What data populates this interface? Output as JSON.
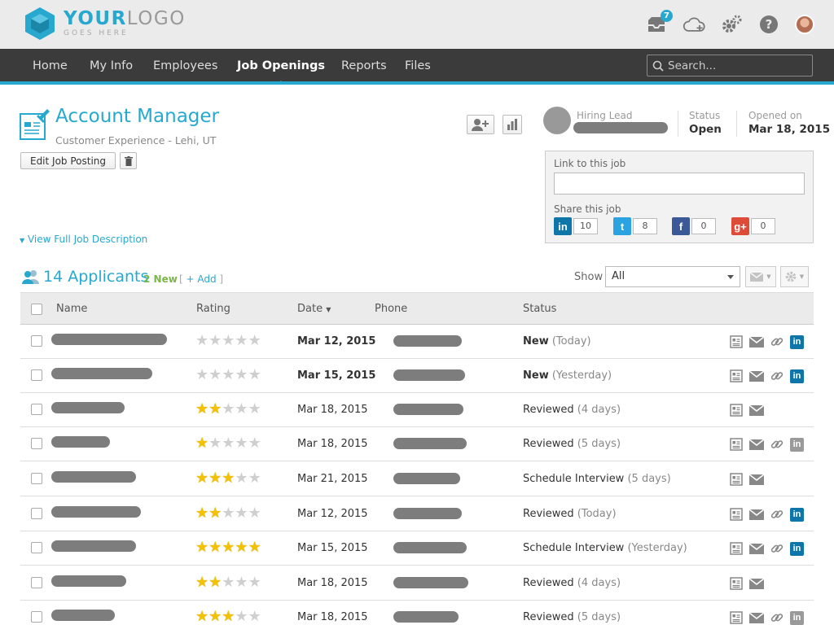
{
  "header": {
    "logo_main_a": "YOUR",
    "logo_main_b": "LOGO",
    "logo_sub": "GOES HERE",
    "inbox_count": "7",
    "icons": [
      "inbox-icon",
      "cloud-upload-icon",
      "gear-icon",
      "help-icon",
      "avatar"
    ]
  },
  "nav": {
    "items": [
      "Home",
      "My Info",
      "Employees",
      "Job Openings",
      "Reports",
      "Files"
    ],
    "active": "Job Openings",
    "search_placeholder": "Search..."
  },
  "job": {
    "title": "Account Manager",
    "subtitle": "Customer Experience - Lehi, UT",
    "edit_label": "Edit Job Posting",
    "view_desc": "View Full Job Description",
    "hiring_lead_label": "Hiring Lead",
    "status_label": "Status",
    "status_value": "Open",
    "opened_label": "Opened on",
    "opened_value": "Mar 18, 2015"
  },
  "share": {
    "link_label": "Link to this job",
    "share_label": "Share this job",
    "networks": [
      {
        "name": "linkedin",
        "glyph": "in",
        "count": "10",
        "color": "#0e76a8"
      },
      {
        "name": "twitter",
        "glyph": "t",
        "count": "8",
        "color": "#2aa3e0"
      },
      {
        "name": "facebook",
        "glyph": "f",
        "count": "0",
        "color": "#3b5998"
      },
      {
        "name": "googleplus",
        "glyph": "g+",
        "count": "0",
        "color": "#dd4b39"
      }
    ]
  },
  "applicants": {
    "count_label": "14 Applicants",
    "new_label": "2 New",
    "add_label": "+ Add",
    "show_label": "Show",
    "show_value": "All",
    "columns": {
      "name": "Name",
      "rating": "Rating",
      "date": "Date",
      "phone": "Phone",
      "status": "Status"
    },
    "rows": [
      {
        "rating": 0,
        "date": "Mar 12, 2015",
        "date_bold": true,
        "status": "New",
        "status_bold": true,
        "status_extra": "(Today)",
        "link": true,
        "linkedin": "blue"
      },
      {
        "rating": 0,
        "date": "Mar 15, 2015",
        "date_bold": true,
        "status": "New",
        "status_bold": true,
        "status_extra": "(Yesterday)",
        "link": true,
        "linkedin": "blue"
      },
      {
        "rating": 2,
        "date": "Mar 18, 2015",
        "date_bold": false,
        "status": "Reviewed",
        "status_bold": false,
        "status_extra": "(4 days)",
        "link": false,
        "linkedin": "none"
      },
      {
        "rating": 1,
        "date": "Mar 18, 2015",
        "date_bold": false,
        "status": "Reviewed",
        "status_bold": false,
        "status_extra": "(5 days)",
        "link": true,
        "linkedin": "gray"
      },
      {
        "rating": 3,
        "date": "Mar 21, 2015",
        "date_bold": false,
        "status": "Schedule Interview",
        "status_bold": false,
        "status_extra": "(5 days)",
        "link": false,
        "linkedin": "none"
      },
      {
        "rating": 2,
        "date": "Mar 12, 2015",
        "date_bold": false,
        "status": "Reviewed",
        "status_bold": false,
        "status_extra": "(Today)",
        "link": true,
        "linkedin": "blue"
      },
      {
        "rating": 5,
        "date": "Mar 15, 2015",
        "date_bold": false,
        "status": "Schedule Interview",
        "status_bold": false,
        "status_extra": "(Yesterday)",
        "link": true,
        "linkedin": "blue"
      },
      {
        "rating": 2,
        "date": "Mar 18, 2015",
        "date_bold": false,
        "status": "Reviewed",
        "status_bold": false,
        "status_extra": "(4 days)",
        "link": false,
        "linkedin": "none"
      },
      {
        "rating": 3,
        "date": "Mar 18, 2015",
        "date_bold": false,
        "status": "Reviewed",
        "status_bold": false,
        "status_extra": "(5 days)",
        "link": true,
        "linkedin": "gray"
      }
    ]
  },
  "colors": {
    "accent": "#27a9cf",
    "new_green": "#7ab648",
    "star": "#f2c200",
    "nav_bg": "#3b3b3b"
  }
}
